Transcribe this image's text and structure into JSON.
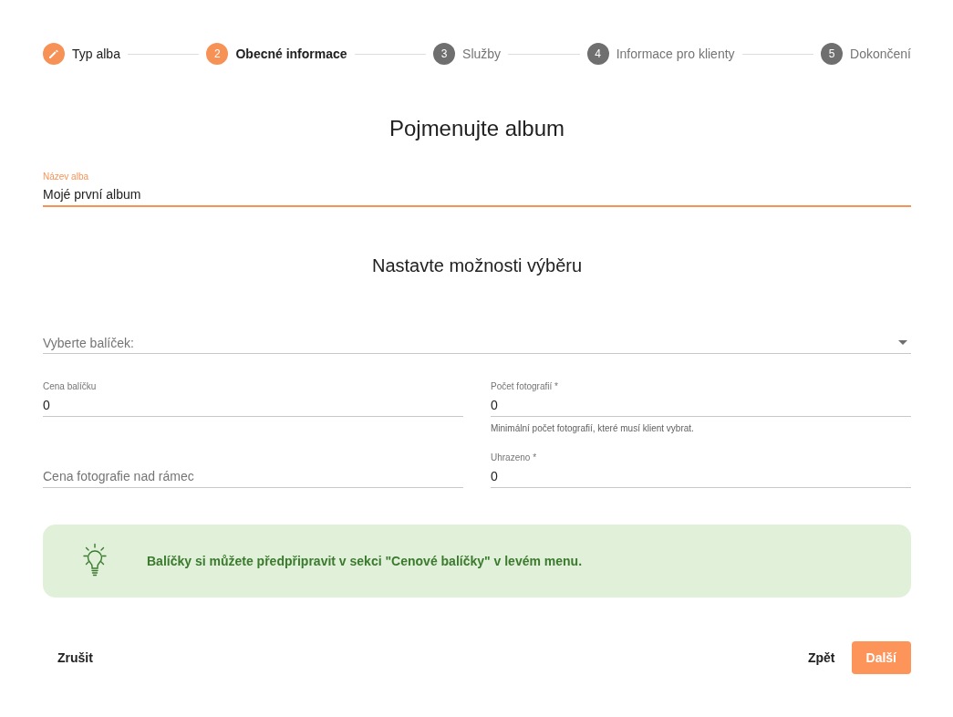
{
  "stepper": {
    "steps": [
      {
        "completed": true,
        "selected": false,
        "label": "Typ alba"
      },
      {
        "completed": false,
        "selected": true,
        "number": "2",
        "label": "Obecné informace"
      },
      {
        "completed": false,
        "selected": false,
        "number": "3",
        "label": "Služby"
      },
      {
        "completed": false,
        "selected": false,
        "number": "4",
        "label": "Informace pro klienty"
      },
      {
        "completed": false,
        "selected": false,
        "number": "5",
        "label": "Dokončení"
      }
    ]
  },
  "name_section": {
    "title": "Pojmenujte album",
    "field": {
      "label": "Název alba",
      "value": "Mojé první album",
      "focused": true
    }
  },
  "selection_section": {
    "title": "Nastavte možnosti výběru",
    "package_select": {
      "placeholder": "Vyberte balíček:"
    },
    "columns": [
      {
        "fields": [
          {
            "label": "Cena balíčku",
            "value": "0"
          },
          {
            "placeholder": "Cena fotografie nad rámec"
          }
        ]
      },
      {
        "fields": [
          {
            "label": "Počet fotografií *",
            "value": "0",
            "helper": "Minimální počet fotografií, které musí klient vybrat."
          },
          {
            "label": "Uhrazeno *",
            "value": "0"
          }
        ]
      }
    ]
  },
  "info_banner": {
    "text": "Balíčky si můžete předpřipravit v sekci \"Cenové balíčky\" v levém menu."
  },
  "actions": {
    "left": [
      {
        "kind": "text",
        "label": "Zrušit"
      }
    ],
    "right": [
      {
        "kind": "text",
        "label": "Zpět"
      },
      {
        "kind": "primary",
        "label": "Další"
      }
    ]
  }
}
